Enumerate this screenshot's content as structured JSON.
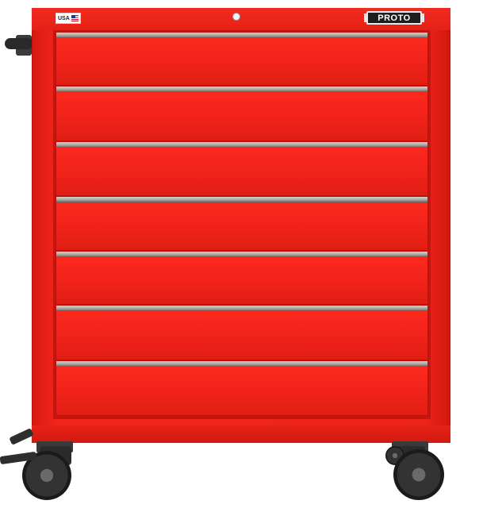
{
  "product": {
    "brand_label": "PROTO",
    "origin_badge": "USA",
    "drawer_count": 7,
    "body_color": "#ef2419",
    "handle_color": "#b4b0ab",
    "caster_color": "#2b2b2b"
  },
  "icons": {
    "origin_flag": "us-flag-icon",
    "lock": "keyhole-lock-icon",
    "side_handle": "side-handle-icon",
    "caster": "caster-wheel-icon",
    "brake": "brake-pedal-icon"
  }
}
